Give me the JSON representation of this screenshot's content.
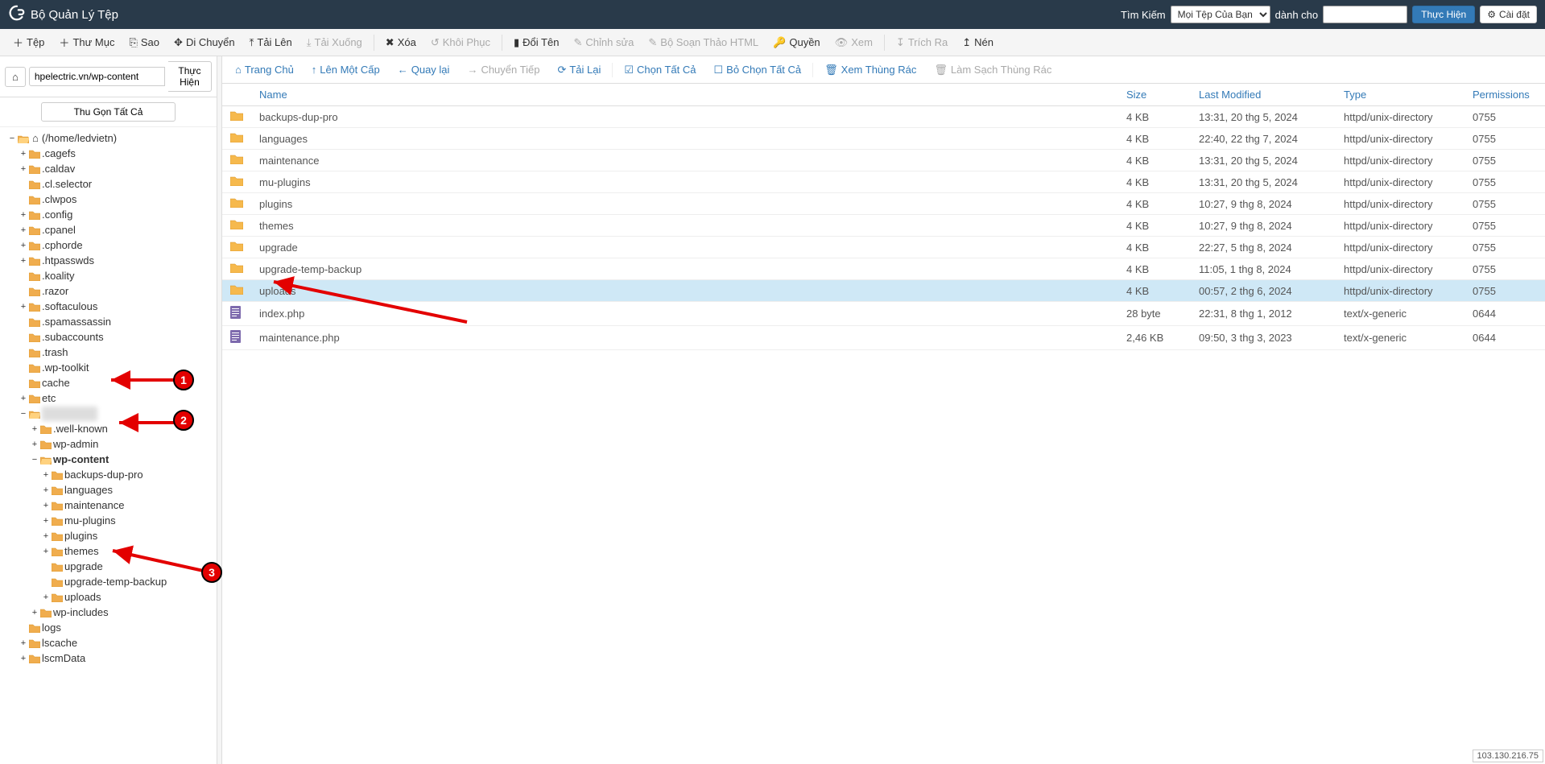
{
  "topbar": {
    "title": "Bộ Quản Lý Tệp",
    "search_label": "Tìm Kiếm",
    "search_scope": "Mọi Tệp Của Bạn",
    "for_label": "dành cho",
    "go": "Thực Hiện",
    "settings": "Cài đặt"
  },
  "toolbar": {
    "file": "Tệp",
    "folder": "Thư Mục",
    "copy": "Sao",
    "move": "Di Chuyển",
    "upload": "Tải Lên",
    "download": "Tải Xuống",
    "delete": "Xóa",
    "restore": "Khôi Phục",
    "rename": "Đổi Tên",
    "edit": "Chỉnh sửa",
    "html_editor": "Bộ Soạn Thảo HTML",
    "permissions": "Quyền",
    "view": "Xem",
    "extract": "Trích Ra",
    "compress": "Nén"
  },
  "pathbar": {
    "value": "hpelectric.vn/wp-content",
    "go": "Thực Hiện",
    "collapse_all": "Thu Gọn Tất Cả"
  },
  "tree": {
    "root": "(/home/ledvietn)",
    "items_level1": [
      {
        "t": "+",
        "n": ".cagefs"
      },
      {
        "t": "+",
        "n": ".caldav"
      },
      {
        "t": "",
        "n": ".cl.selector"
      },
      {
        "t": "",
        "n": ".clwpos"
      },
      {
        "t": "+",
        "n": ".config"
      },
      {
        "t": "+",
        "n": ".cpanel"
      },
      {
        "t": "+",
        "n": ".cphorde"
      },
      {
        "t": "+",
        "n": ".htpasswds"
      },
      {
        "t": "",
        "n": ".koality"
      },
      {
        "t": "",
        "n": ".razor"
      },
      {
        "t": "+",
        "n": ".softaculous"
      },
      {
        "t": "",
        "n": ".spamassassin"
      },
      {
        "t": "",
        "n": ".subaccounts"
      },
      {
        "t": "",
        "n": ".trash"
      },
      {
        "t": "",
        "n": ".wp-toolkit"
      },
      {
        "t": "",
        "n": "cache"
      },
      {
        "t": "+",
        "n": "etc"
      }
    ],
    "site_folder_label": "hpelectric.vn",
    "site_children": [
      {
        "t": "+",
        "n": ".well-known"
      },
      {
        "t": "+",
        "n": "wp-admin"
      }
    ],
    "wp_content_label": "wp-content",
    "wp_content_children": [
      {
        "t": "+",
        "n": "backups-dup-pro"
      },
      {
        "t": "+",
        "n": "languages"
      },
      {
        "t": "+",
        "n": "maintenance"
      },
      {
        "t": "+",
        "n": "mu-plugins"
      },
      {
        "t": "+",
        "n": "plugins"
      },
      {
        "t": "+",
        "n": "themes"
      },
      {
        "t": "",
        "n": "upgrade"
      },
      {
        "t": "",
        "n": "upgrade-temp-backup"
      },
      {
        "t": "+",
        "n": "uploads"
      }
    ],
    "after_site": [
      {
        "t": "+",
        "n": "wp-includes"
      },
      {
        "t": "",
        "n": "logs"
      },
      {
        "t": "+",
        "n": "lscache"
      },
      {
        "t": "+",
        "n": "lscmData"
      }
    ]
  },
  "actionbar": {
    "home": "Trang Chủ",
    "up": "Lên Một Cấp",
    "back": "Quay lại",
    "forward": "Chuyển Tiếp",
    "reload": "Tải Lại",
    "select_all": "Chọn Tất Cả",
    "deselect_all": "Bỏ Chọn Tất Cả",
    "trash": "Xem Thùng Rác",
    "empty_trash": "Làm Sạch Thùng Rác"
  },
  "columns": {
    "name": "Name",
    "size": "Size",
    "modified": "Last Modified",
    "type": "Type",
    "perms": "Permissions"
  },
  "rows": [
    {
      "kind": "folder",
      "name": "backups-dup-pro",
      "size": "4 KB",
      "mod": "13:31, 20 thg 5, 2024",
      "type": "httpd/unix-directory",
      "perm": "0755"
    },
    {
      "kind": "folder",
      "name": "languages",
      "size": "4 KB",
      "mod": "22:40, 22 thg 7, 2024",
      "type": "httpd/unix-directory",
      "perm": "0755"
    },
    {
      "kind": "folder",
      "name": "maintenance",
      "size": "4 KB",
      "mod": "13:31, 20 thg 5, 2024",
      "type": "httpd/unix-directory",
      "perm": "0755"
    },
    {
      "kind": "folder",
      "name": "mu-plugins",
      "size": "4 KB",
      "mod": "13:31, 20 thg 5, 2024",
      "type": "httpd/unix-directory",
      "perm": "0755"
    },
    {
      "kind": "folder",
      "name": "plugins",
      "size": "4 KB",
      "mod": "10:27, 9 thg 8, 2024",
      "type": "httpd/unix-directory",
      "perm": "0755"
    },
    {
      "kind": "folder",
      "name": "themes",
      "size": "4 KB",
      "mod": "10:27, 9 thg 8, 2024",
      "type": "httpd/unix-directory",
      "perm": "0755"
    },
    {
      "kind": "folder",
      "name": "upgrade",
      "size": "4 KB",
      "mod": "22:27, 5 thg 8, 2024",
      "type": "httpd/unix-directory",
      "perm": "0755"
    },
    {
      "kind": "folder",
      "name": "upgrade-temp-backup",
      "size": "4 KB",
      "mod": "11:05, 1 thg 8, 2024",
      "type": "httpd/unix-directory",
      "perm": "0755"
    },
    {
      "kind": "folder",
      "name": "uploads",
      "size": "4 KB",
      "mod": "00:57, 2 thg 6, 2024",
      "type": "httpd/unix-directory",
      "perm": "0755",
      "selected": true
    },
    {
      "kind": "file",
      "name": "index.php",
      "size": "28 byte",
      "mod": "22:31, 8 thg 1, 2012",
      "type": "text/x-generic",
      "perm": "0644"
    },
    {
      "kind": "file",
      "name": "maintenance.php",
      "size": "2,46 KB",
      "mod": "09:50, 3 thg 3, 2023",
      "type": "text/x-generic",
      "perm": "0644"
    }
  ],
  "ip": "103.130.216.75",
  "annotations": {
    "a1": "1",
    "a2": "2",
    "a3": "3"
  }
}
